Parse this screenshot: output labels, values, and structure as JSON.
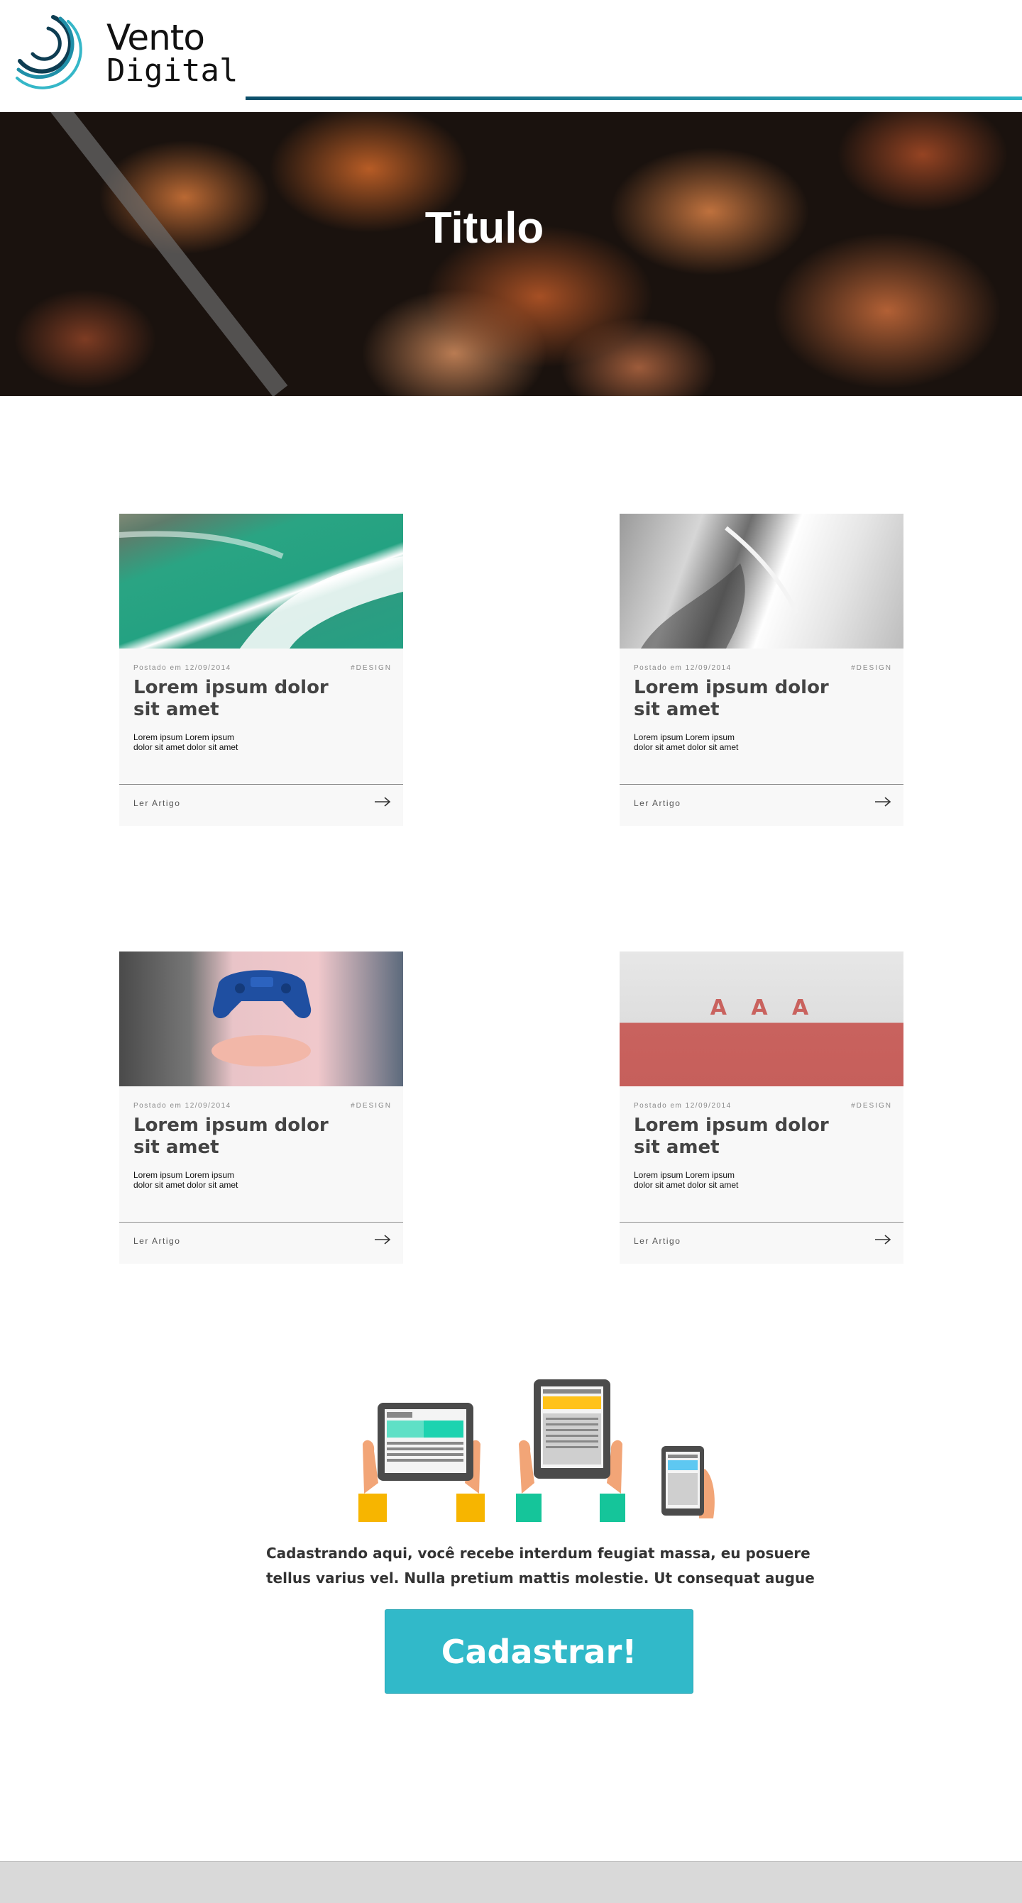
{
  "brand": {
    "name_line1": "Vento",
    "name_line2": "Digital",
    "accent": "#2fb8c8",
    "accent_dark": "#0c4f6a"
  },
  "hero": {
    "title": "Titulo"
  },
  "posts": [
    {
      "image": "aerial-sea-waves",
      "meta": "Postado em 12/09/2014",
      "tag": "#DESIGN",
      "title": "Lorem ipsum dolor sit amet",
      "excerpt": "Lorem ipsum Lorem ipsum dolor sit amet dolor sit amet",
      "link": "Ler Artigo"
    },
    {
      "image": "sand-dunes-grayscale",
      "meta": "Postado em 12/09/2014",
      "tag": "#DESIGN",
      "title": "Lorem ipsum dolor sit amet",
      "excerpt": "Lorem ipsum Lorem ipsum dolor sit amet dolor sit amet",
      "link": "Ler Artigo"
    },
    {
      "image": "floating-game-controller",
      "meta": "Postado em 12/09/2014",
      "tag": "#DESIGN",
      "title": "Lorem ipsum dolor sit amet",
      "excerpt": "Lorem ipsum Lorem ipsum dolor sit amet dolor sit amet",
      "link": "Ler Artigo"
    },
    {
      "image": "red-wall-letters",
      "meta": "Postado em 12/09/2014",
      "tag": "#DESIGN",
      "title": "Lorem ipsum dolor sit amet",
      "excerpt": "Lorem ipsum Lorem ipsum dolor sit amet dolor sit amet",
      "link": "Ler Artigo"
    }
  ],
  "wall_letters": "A A A",
  "promo": {
    "text": "Cadastrando aqui, você recebe  interdum feugiat massa, eu posuere tellus varius vel. Nulla pretium mattis molestie. Ut consequat augue",
    "button": "Cadastrar!",
    "button_color": "#31b9c9"
  }
}
